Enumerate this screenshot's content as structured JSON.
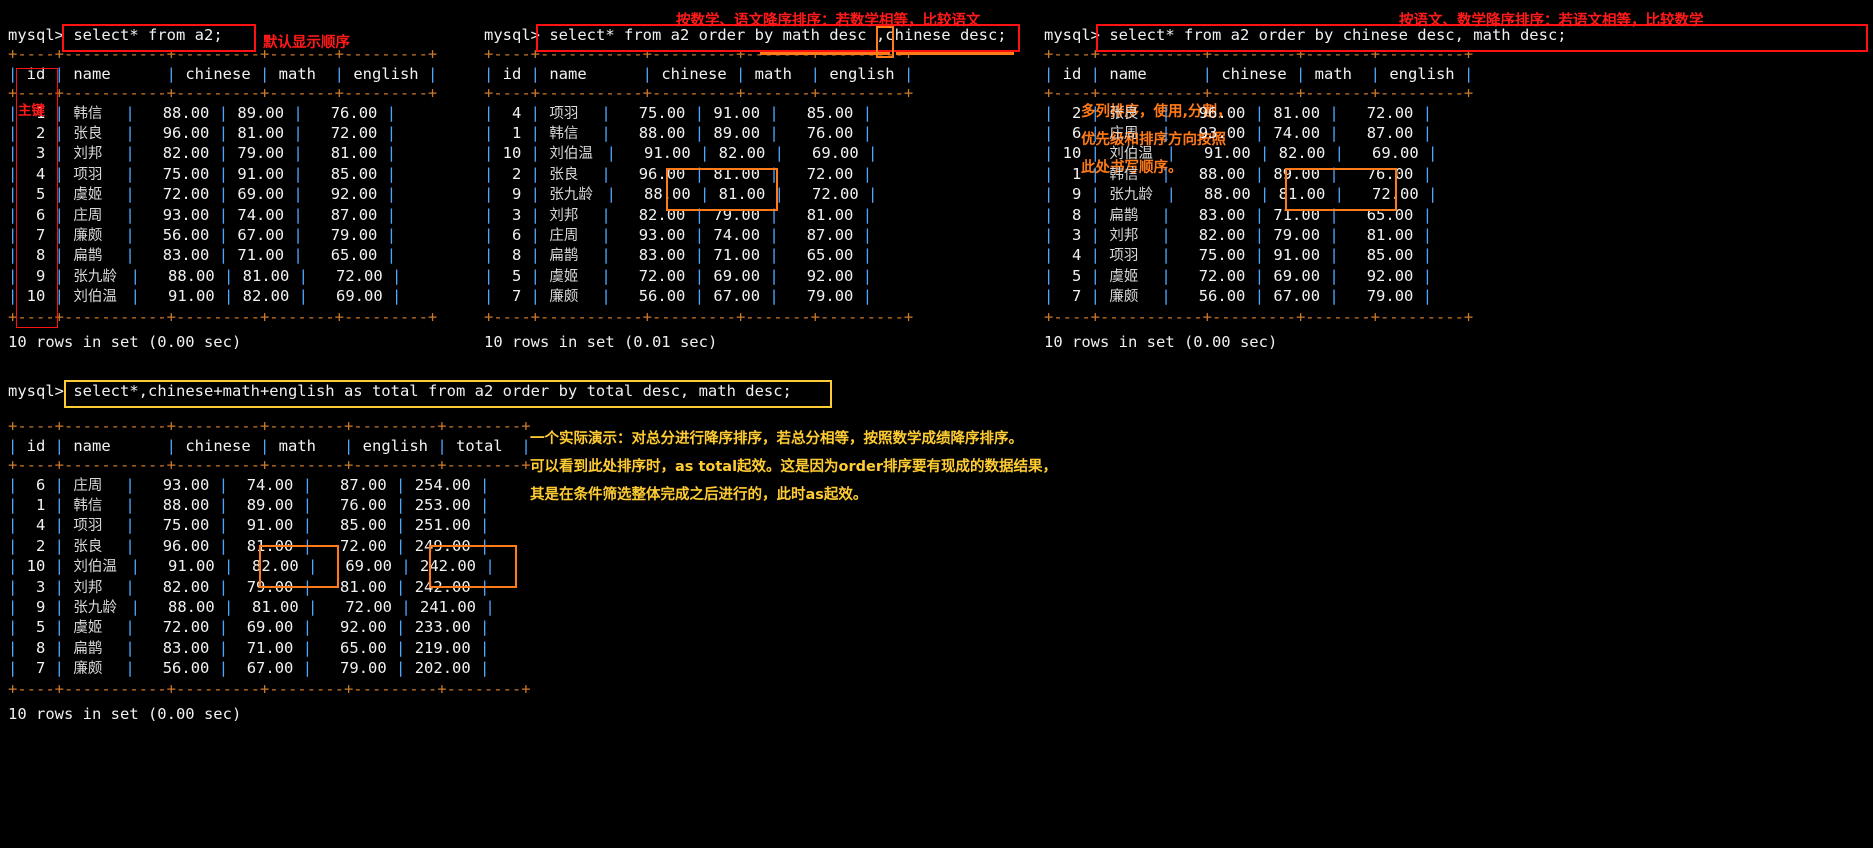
{
  "terminal": {
    "prompt": "mysql>",
    "columns": [
      "id",
      "name",
      "chinese",
      "math",
      "english"
    ],
    "columns_with_total": [
      "id",
      "name",
      "chinese",
      "math",
      "english",
      "total"
    ]
  },
  "block1": {
    "command": "select* from a2;",
    "annotation_default_order": "默认显示顺序",
    "annotation_primary_key": "主键",
    "status": "10 rows in set (0.00 sec)",
    "rows": [
      {
        "id": "1",
        "name": "韩信",
        "chinese": "88.00",
        "math": "89.00",
        "english": "76.00"
      },
      {
        "id": "2",
        "name": "张良",
        "chinese": "96.00",
        "math": "81.00",
        "english": "72.00"
      },
      {
        "id": "3",
        "name": "刘邦",
        "chinese": "82.00",
        "math": "79.00",
        "english": "81.00"
      },
      {
        "id": "4",
        "name": "项羽",
        "chinese": "75.00",
        "math": "91.00",
        "english": "85.00"
      },
      {
        "id": "5",
        "name": "虞姬",
        "chinese": "72.00",
        "math": "69.00",
        "english": "92.00"
      },
      {
        "id": "6",
        "name": "庄周",
        "chinese": "93.00",
        "math": "74.00",
        "english": "87.00"
      },
      {
        "id": "7",
        "name": "廉颇",
        "chinese": "56.00",
        "math": "67.00",
        "english": "79.00"
      },
      {
        "id": "8",
        "name": "扁鹊",
        "chinese": "83.00",
        "math": "71.00",
        "english": "65.00"
      },
      {
        "id": "9",
        "name": "张九龄",
        "chinese": "88.00",
        "math": "81.00",
        "english": "72.00"
      },
      {
        "id": "10",
        "name": "刘伯温",
        "chinese": "91.00",
        "math": "82.00",
        "english": "69.00"
      }
    ]
  },
  "block2": {
    "command": "select* from a2 order by math desc ,chinese desc;",
    "annotation_red": "按数学、语文降序排序：若数学相等，比较语文",
    "annotation_orange_line1": "多列排序，使用,分割，",
    "annotation_orange_line2": "优先级和排序方向按照",
    "annotation_orange_line3": "此处书写顺序。",
    "status": "10 rows in set (0.01 sec)",
    "rows": [
      {
        "id": "4",
        "name": "项羽",
        "chinese": "75.00",
        "math": "91.00",
        "english": "85.00"
      },
      {
        "id": "1",
        "name": "韩信",
        "chinese": "88.00",
        "math": "89.00",
        "english": "76.00"
      },
      {
        "id": "10",
        "name": "刘伯温",
        "chinese": "91.00",
        "math": "82.00",
        "english": "69.00"
      },
      {
        "id": "2",
        "name": "张良",
        "chinese": "96.00",
        "math": "81.00",
        "english": "72.00"
      },
      {
        "id": "9",
        "name": "张九龄",
        "chinese": "88.00",
        "math": "81.00",
        "english": "72.00"
      },
      {
        "id": "3",
        "name": "刘邦",
        "chinese": "82.00",
        "math": "79.00",
        "english": "81.00"
      },
      {
        "id": "6",
        "name": "庄周",
        "chinese": "93.00",
        "math": "74.00",
        "english": "87.00"
      },
      {
        "id": "8",
        "name": "扁鹊",
        "chinese": "83.00",
        "math": "71.00",
        "english": "65.00"
      },
      {
        "id": "5",
        "name": "虞姬",
        "chinese": "72.00",
        "math": "69.00",
        "english": "92.00"
      },
      {
        "id": "7",
        "name": "廉颇",
        "chinese": "56.00",
        "math": "67.00",
        "english": "79.00"
      }
    ]
  },
  "block3": {
    "command": "select* from a2 order by chinese desc, math desc;",
    "annotation_red": "按语文、数学降序排序：若语文相等，比较数学",
    "status": "10 rows in set (0.00 sec)",
    "rows": [
      {
        "id": "2",
        "name": "张良",
        "chinese": "96.00",
        "math": "81.00",
        "english": "72.00"
      },
      {
        "id": "6",
        "name": "庄周",
        "chinese": "93.00",
        "math": "74.00",
        "english": "87.00"
      },
      {
        "id": "10",
        "name": "刘伯温",
        "chinese": "91.00",
        "math": "82.00",
        "english": "69.00"
      },
      {
        "id": "1",
        "name": "韩信",
        "chinese": "88.00",
        "math": "89.00",
        "english": "76.00"
      },
      {
        "id": "9",
        "name": "张九龄",
        "chinese": "88.00",
        "math": "81.00",
        "english": "72.00"
      },
      {
        "id": "8",
        "name": "扁鹊",
        "chinese": "83.00",
        "math": "71.00",
        "english": "65.00"
      },
      {
        "id": "3",
        "name": "刘邦",
        "chinese": "82.00",
        "math": "79.00",
        "english": "81.00"
      },
      {
        "id": "4",
        "name": "项羽",
        "chinese": "75.00",
        "math": "91.00",
        "english": "85.00"
      },
      {
        "id": "5",
        "name": "虞姬",
        "chinese": "72.00",
        "math": "69.00",
        "english": "92.00"
      },
      {
        "id": "7",
        "name": "廉颇",
        "chinese": "56.00",
        "math": "67.00",
        "english": "79.00"
      }
    ]
  },
  "block4": {
    "command": "select*,chinese+math+english as total from a2 order by total desc, math desc;",
    "annotation_line1": "一个实际演示：对总分进行降序排序，若总分相等，按照数学成绩降序排序。",
    "annotation_line2": "可以看到此处排序时，as total起效。这是因为order排序要有现成的数据结果，",
    "annotation_line3": "其是在条件筛选整体完成之后进行的，此时as起效。",
    "status": "10 rows in set (0.00 sec)",
    "rows": [
      {
        "id": "6",
        "name": "庄周",
        "chinese": "93.00",
        "math": "74.00",
        "english": "87.00",
        "total": "254.00"
      },
      {
        "id": "1",
        "name": "韩信",
        "chinese": "88.00",
        "math": "89.00",
        "english": "76.00",
        "total": "253.00"
      },
      {
        "id": "4",
        "name": "项羽",
        "chinese": "75.00",
        "math": "91.00",
        "english": "85.00",
        "total": "251.00"
      },
      {
        "id": "2",
        "name": "张良",
        "chinese": "96.00",
        "math": "81.00",
        "english": "72.00",
        "total": "249.00"
      },
      {
        "id": "10",
        "name": "刘伯温",
        "chinese": "91.00",
        "math": "82.00",
        "english": "69.00",
        "total": "242.00"
      },
      {
        "id": "3",
        "name": "刘邦",
        "chinese": "82.00",
        "math": "79.00",
        "english": "81.00",
        "total": "242.00"
      },
      {
        "id": "9",
        "name": "张九龄",
        "chinese": "88.00",
        "math": "81.00",
        "english": "72.00",
        "total": "241.00"
      },
      {
        "id": "5",
        "name": "虞姬",
        "chinese": "72.00",
        "math": "69.00",
        "english": "92.00",
        "total": "233.00"
      },
      {
        "id": "8",
        "name": "扁鹊",
        "chinese": "83.00",
        "math": "71.00",
        "english": "65.00",
        "total": "219.00"
      },
      {
        "id": "7",
        "name": "廉颇",
        "chinese": "56.00",
        "math": "67.00",
        "english": "79.00",
        "total": "202.00"
      }
    ]
  },
  "colors": {
    "background": "#000000",
    "text": "#f0f0f0",
    "rule": "#cf7a2a",
    "pipe": "#4ea6ff",
    "highlight_red": "#ff1111",
    "highlight_orange": "#ff7a18",
    "highlight_yellow": "#ffcc33"
  }
}
